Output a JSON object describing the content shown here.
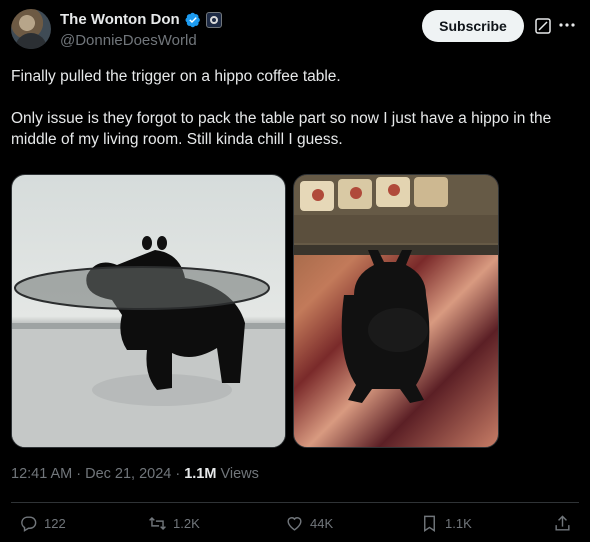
{
  "author": {
    "display_name": "The Wonton Don",
    "handle": "@DonnieDoesWorld"
  },
  "header": {
    "subscribe_label": "Subscribe"
  },
  "tweet": {
    "paragraphs": [
      "Finally pulled the trigger on a hippo coffee table.",
      "Only issue is they forgot to pack the table part so now I just have a hippo in the middle of my living room. Still kinda chill I guess."
    ]
  },
  "meta": {
    "time": "12:41 AM",
    "separator": "·",
    "date": "Dec 21, 2024",
    "separator2": "·",
    "views_count": "1.1M",
    "views_label": "Views"
  },
  "actions": {
    "replies": "122",
    "reposts": "1.2K",
    "likes": "44K",
    "bookmarks": "1.1K"
  },
  "icons": {
    "verified": "verified-check-icon",
    "org": "affiliate-badge-icon",
    "grok": "grok-icon",
    "more": "more-icon",
    "reply": "reply-icon",
    "repost": "repost-icon",
    "like": "heart-icon",
    "bookmark": "bookmark-icon",
    "share": "share-icon"
  },
  "colors": {
    "background": "#000000",
    "text": "#e7e9ea",
    "muted": "#71767b",
    "verified": "#1d9bf0"
  }
}
